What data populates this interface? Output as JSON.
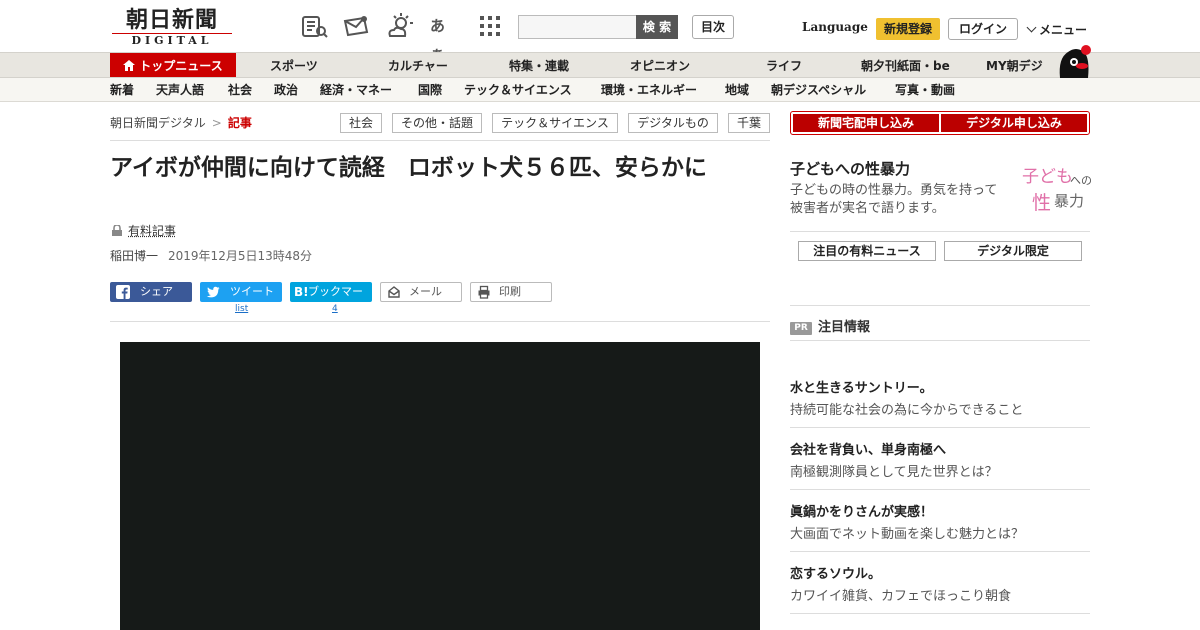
{
  "header": {
    "logo_main": "朝日新聞",
    "logo_sub": "DIGITAL",
    "search_placeholder": "",
    "search_button": "検 索",
    "index_button": "目次",
    "language": "Language",
    "signup": "新規登録",
    "login": "ログイン",
    "menu": "メニュー",
    "font_size_glyph": "あぁ"
  },
  "nav_primary": [
    "トップニュース",
    "スポーツ",
    "カルチャー",
    "特集・連載",
    "オピニオン",
    "ライフ",
    "朝夕刊紙面・be",
    "MY朝デジ"
  ],
  "nav_secondary": [
    "新着",
    "天声人語",
    "社会",
    "政治",
    "経済・マネー",
    "国際",
    "テック＆サイエンス",
    "環境・エネルギー",
    "地域",
    "朝デジスペシャル",
    "写真・動画"
  ],
  "breadcrumb": {
    "home": "朝日新聞デジタル",
    "sep": ">",
    "current": "記事"
  },
  "tags": [
    "社会",
    "その他・話題",
    "テック＆サイエンス",
    "デジタルもの",
    "千葉"
  ],
  "article": {
    "title": "アイボが仲間に向けて読経　ロボット犬５６匹、安らかに",
    "paid_label": "有料記事",
    "author": "稲田博一",
    "date": "2019年12月5日13時48分"
  },
  "share": {
    "facebook": "シェア",
    "twitter": "ツイート",
    "hatena": "ブックマーク",
    "hatena_mark": "B!",
    "mail": "メール",
    "print": "印刷",
    "twitter_count": "list",
    "hatena_count": "4"
  },
  "sidebar": {
    "subscribe_paper": "新聞宅配申し込み",
    "subscribe_digital": "デジタル申し込み",
    "feature_title": "子どもへの性暴力",
    "feature_desc": "子どもの時の性暴力。勇気を持って被害者が実名で語ります。",
    "feature_logo_a": "子ども",
    "feature_logo_b": "への",
    "feature_logo_c": "性",
    "feature_logo_d": "暴力",
    "pill_paid": "注目の有料ニュース",
    "pill_digital": "デジタル限定",
    "pr_badge": "PR",
    "pr_heading": "注目情報",
    "pr_items": [
      {
        "title": "水と生きるサントリー。",
        "desc": "持続可能な社会の為に今からできること"
      },
      {
        "title": "会社を背負い、単身南極へ",
        "desc": "南極観測隊員として見た世界とは？"
      },
      {
        "title": "眞鍋かをりさんが実感！",
        "desc": "大画面でネット動画を楽しむ魅力とは？"
      },
      {
        "title": "恋するソウル。",
        "desc": "カワイイ雑貨、カフェでほっこり朝食"
      }
    ]
  },
  "colors": {
    "brand_red": "#cc0000",
    "signup_yellow": "#f0c030",
    "facebook": "#3b5998",
    "twitter": "#1da1f2",
    "hatena": "#00a4de"
  }
}
